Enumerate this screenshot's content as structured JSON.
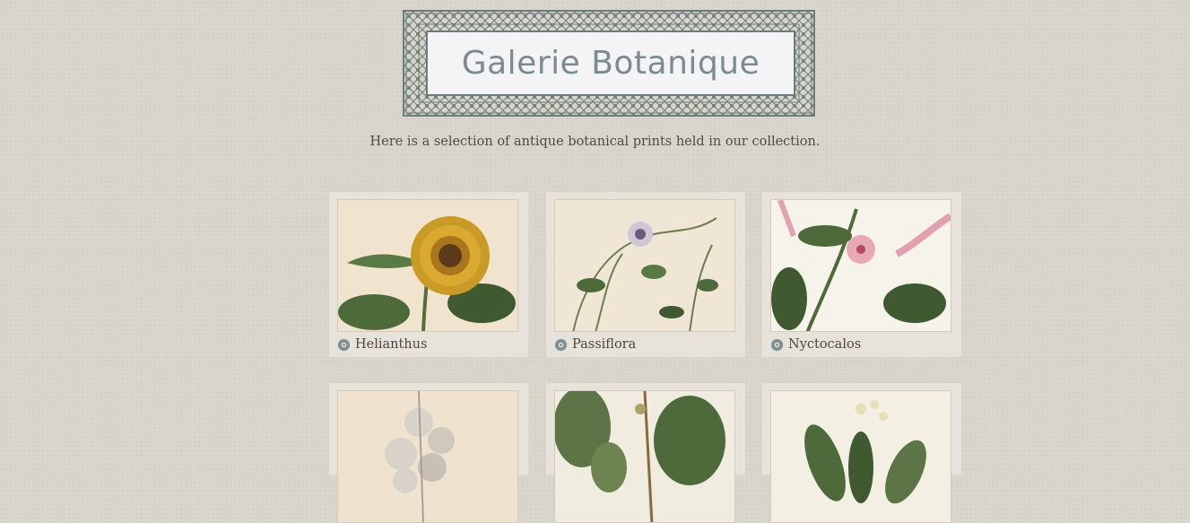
{
  "header": {
    "title": "Galerie Botanique"
  },
  "intro": {
    "text": "Here is a selection of antique botanical prints held in our collection."
  },
  "gallery": {
    "items": [
      {
        "label": "Helianthus",
        "icon": "gear-icon"
      },
      {
        "label": "Passiflora",
        "icon": "gear-icon"
      },
      {
        "label": "Nyctocalos",
        "icon": "gear-icon"
      },
      {
        "label": "",
        "icon": "gear-icon"
      },
      {
        "label": "",
        "icon": "gear-icon"
      },
      {
        "label": "",
        "icon": "gear-icon"
      }
    ]
  },
  "colors": {
    "background": "#d8d4ca",
    "frame": "#6d7d79",
    "title": "#7a8c8f",
    "card": "#e8e3da"
  }
}
